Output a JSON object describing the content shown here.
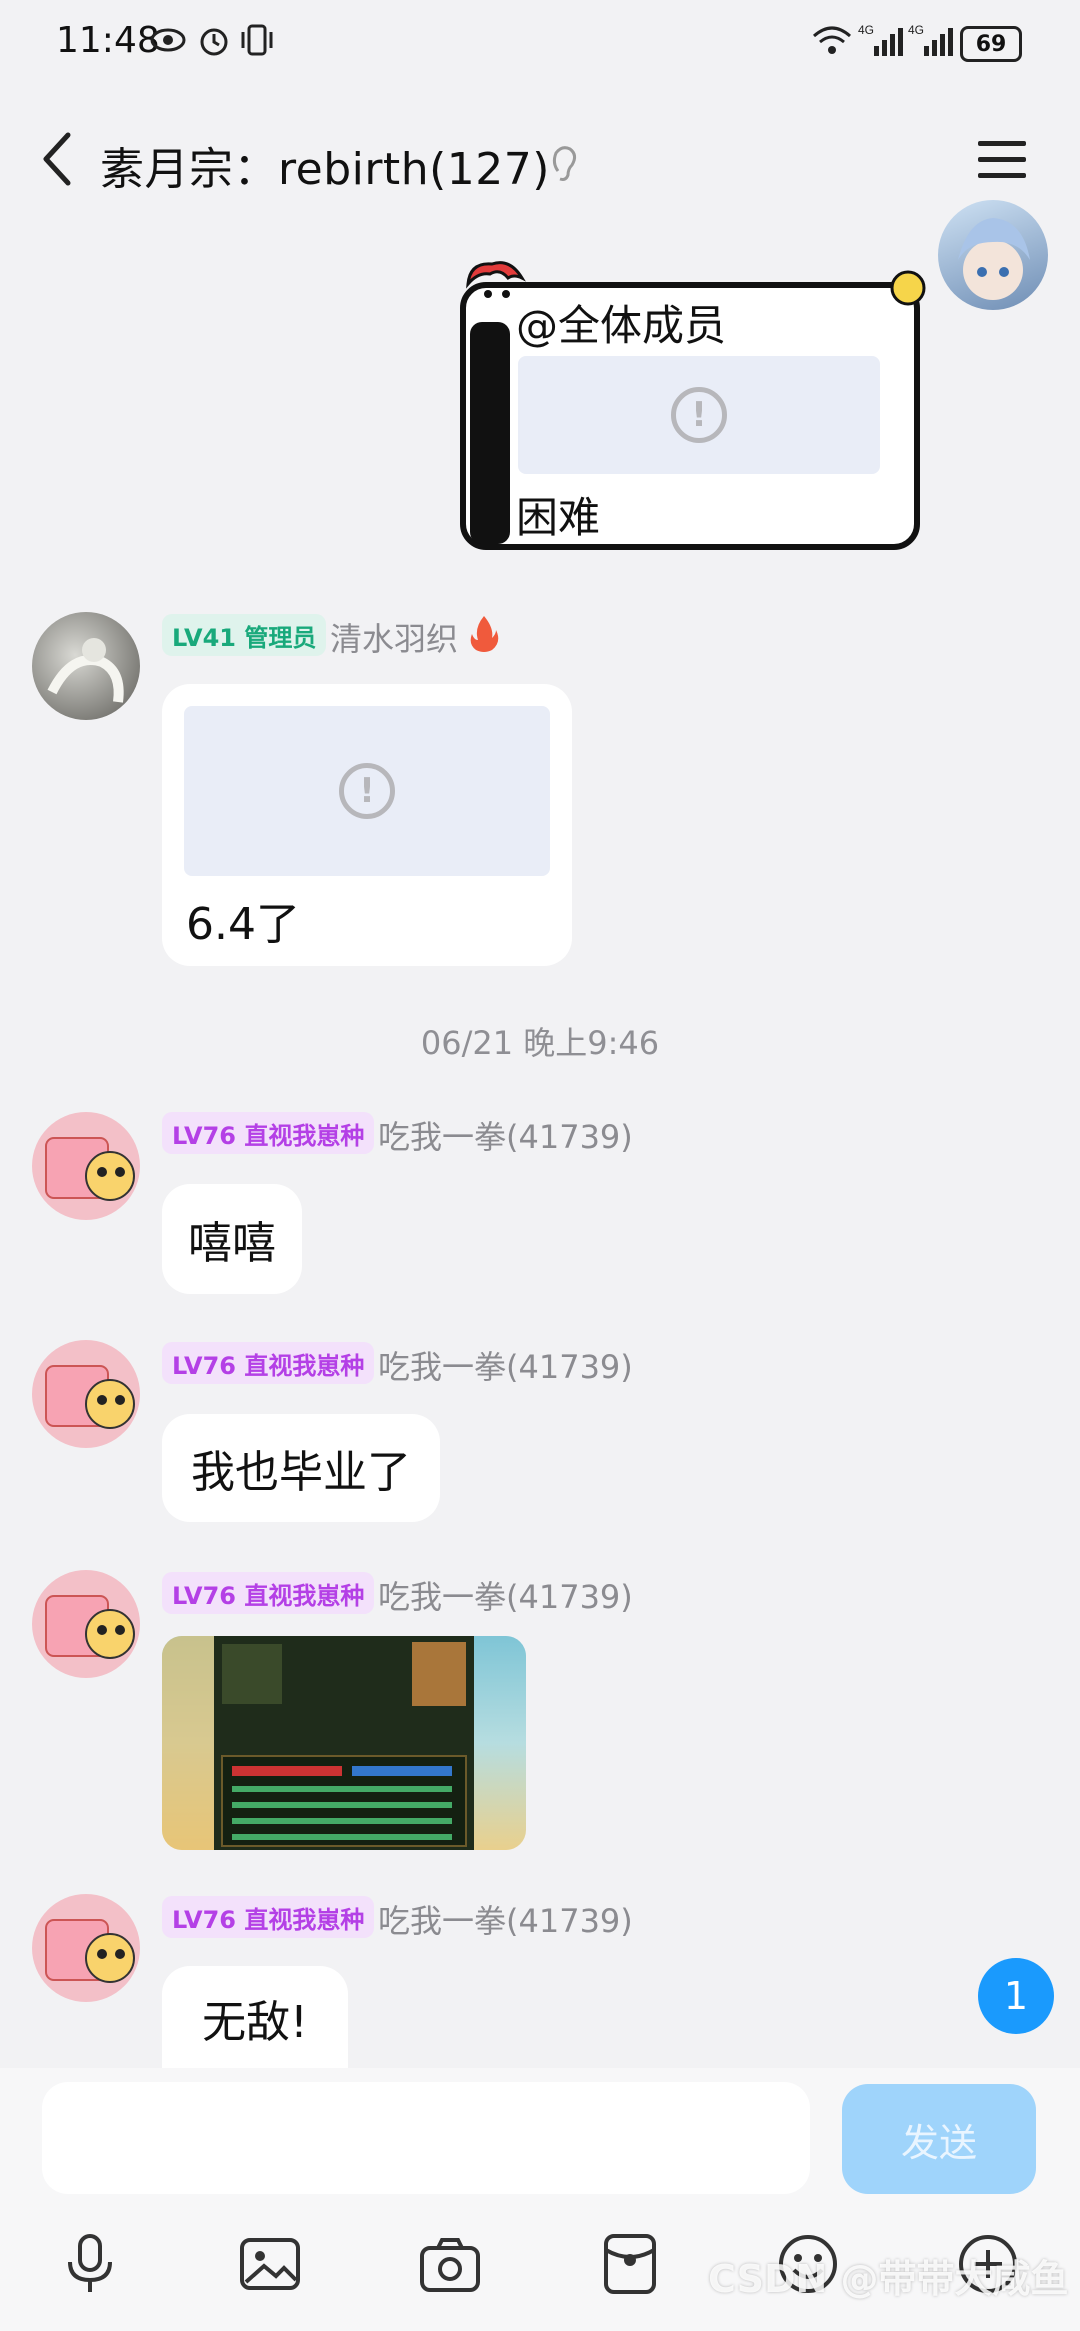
{
  "status_bar": {
    "time": "11:48",
    "battery": "69"
  },
  "nav": {
    "title": "素月宗：rebirth(127)"
  },
  "messages": [
    {
      "type": "announcement",
      "mention": "@全体成员",
      "text": "困难"
    },
    {
      "badge": "LV41 管理员",
      "name": "清水羽织",
      "text": "6.4了"
    },
    {
      "time": "06/21 晚上9:46"
    },
    {
      "badge": "LV76 直视我崽种",
      "name": "吃我一拳(41739)",
      "text": "嘻嘻"
    },
    {
      "badge": "LV76 直视我崽种",
      "name": "吃我一拳(41739)",
      "text": "我也毕业了"
    },
    {
      "badge": "LV76 直视我崽种",
      "name": "吃我一拳(41739)"
    },
    {
      "badge": "LV76 直视我崽种",
      "name": "吃我一拳(41739)",
      "text": "无敌!"
    }
  ],
  "unread_count": "1",
  "input": {
    "placeholder": "",
    "send_label": "发送"
  },
  "toolbar": [
    "mic-icon",
    "image-icon",
    "camera-icon",
    "red-packet-icon",
    "emoji-icon",
    "plus-icon"
  ],
  "watermark": "CSDN @带带大咸鱼",
  "colors": {
    "send": "#9fd4fb",
    "accent": "#1a9afd",
    "badge_purple": "#b440e6",
    "badge_green": "#19a97b"
  }
}
